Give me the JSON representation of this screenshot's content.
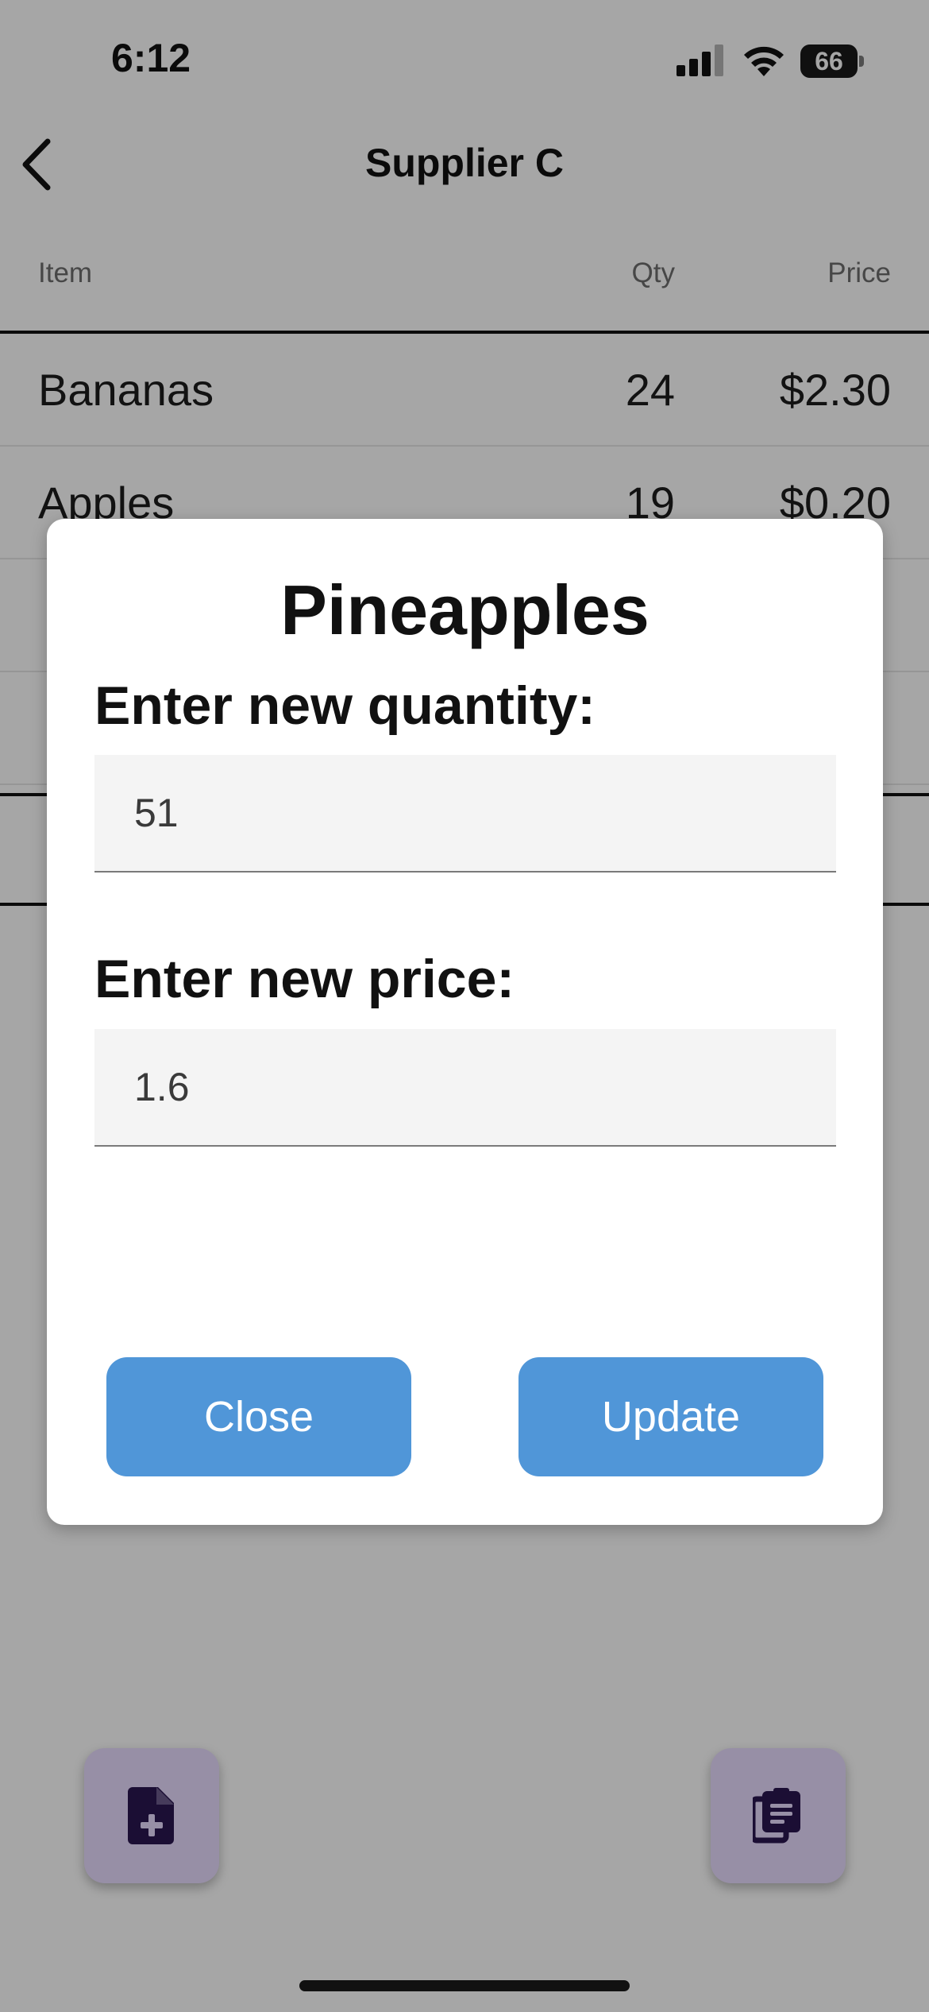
{
  "status_bar": {
    "time": "6:12",
    "battery_level": "66",
    "icons": [
      "signal-icon",
      "wifi-icon",
      "battery-icon"
    ]
  },
  "nav": {
    "title": "Supplier C",
    "back_icon": "chevron-left-icon"
  },
  "table": {
    "columns": [
      "Item",
      "Qty",
      "Price"
    ],
    "rows": [
      {
        "item": "Bananas",
        "qty": "24",
        "price": "$2.30"
      },
      {
        "item": "Apples",
        "qty": "19",
        "price": "$0.20"
      },
      {
        "item": "",
        "qty": "",
        "price": ""
      },
      {
        "item": "",
        "qty": "",
        "price": ""
      }
    ]
  },
  "modal": {
    "title": "Pineapples",
    "quantity_label": "Enter new quantity:",
    "quantity_value": "51",
    "price_label": "Enter new price:",
    "price_value": "1.6",
    "close_label": "Close",
    "update_label": "Update"
  },
  "fabs": {
    "left_icon": "file-add-icon",
    "right_icon": "clipboard-list-icon"
  },
  "colors": {
    "accent_button": "#5096d8",
    "fab_background": "#e9dcff",
    "fab_icon": "#2a1650",
    "overlay": "rgba(0,0,0,0.35)"
  }
}
